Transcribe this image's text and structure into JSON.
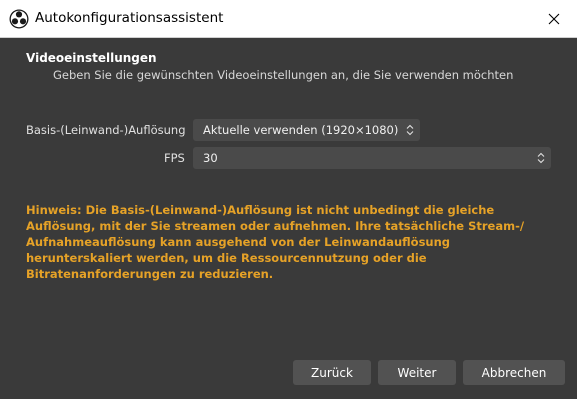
{
  "window": {
    "title": "Autokonfigurationsassistent"
  },
  "section": {
    "title": "Videoeinstellungen",
    "subtitle": "Geben Sie die gewünschten Videoeinstellungen an, die Sie verwenden möchten"
  },
  "fields": {
    "resolution_label": "Basis-(Leinwand-)Auflösung",
    "resolution_value": "Aktuelle verwenden (1920×1080)",
    "fps_label": "FPS",
    "fps_value": "30"
  },
  "note": "Hinweis: Die Basis-(Leinwand-)Auflösung ist nicht unbedingt die gleiche Auflösung, mit der Sie streamen oder aufnehmen. Ihre tatsächliche Stream-/ Aufnahmeauflösung kann ausgehend von der Leinwandauflösung herunterskaliert werden, um die Ressourcennutzung oder die Bitratenanforderungen zu reduzieren.",
  "buttons": {
    "back": "Zurück",
    "next": "Weiter",
    "cancel": "Abbrechen"
  },
  "colors": {
    "background": "#3a3a3a",
    "note": "#e6a227",
    "button": "#525252"
  },
  "icons": {
    "app": "obs-logo-icon",
    "close": "close-icon",
    "spinner": "up-down-chevron-icon"
  }
}
